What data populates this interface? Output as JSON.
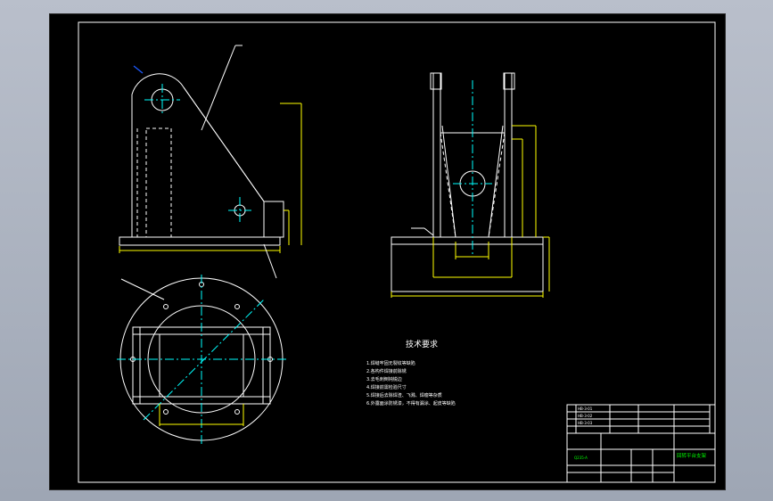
{
  "drawing": {
    "tech_title": "技术要求",
    "notes": [
      "1.焊缝牢固无裂纹等缺陷",
      "2.各构件焊接前除锈",
      "3.去毛刺倒钝锐边",
      "4.焊接前需检验尺寸",
      "5.焊接后去除焊渣、飞溅、焊瘤等杂质",
      "6.外露面涂防锈漆，不得有漏涂、起皮等缺陷"
    ],
    "title_block": {
      "drawing_name": "回转平台支架",
      "material": "Q235-A",
      "row1": "HB-3-01",
      "row2": "HB-3-02",
      "row3": "HB-3-03"
    }
  },
  "colors": {
    "outline": "#ffffff",
    "dimension": "#ffff00",
    "centerline": "#00ffff",
    "leader": "#1e5bff",
    "title_text": "#00ff00"
  }
}
